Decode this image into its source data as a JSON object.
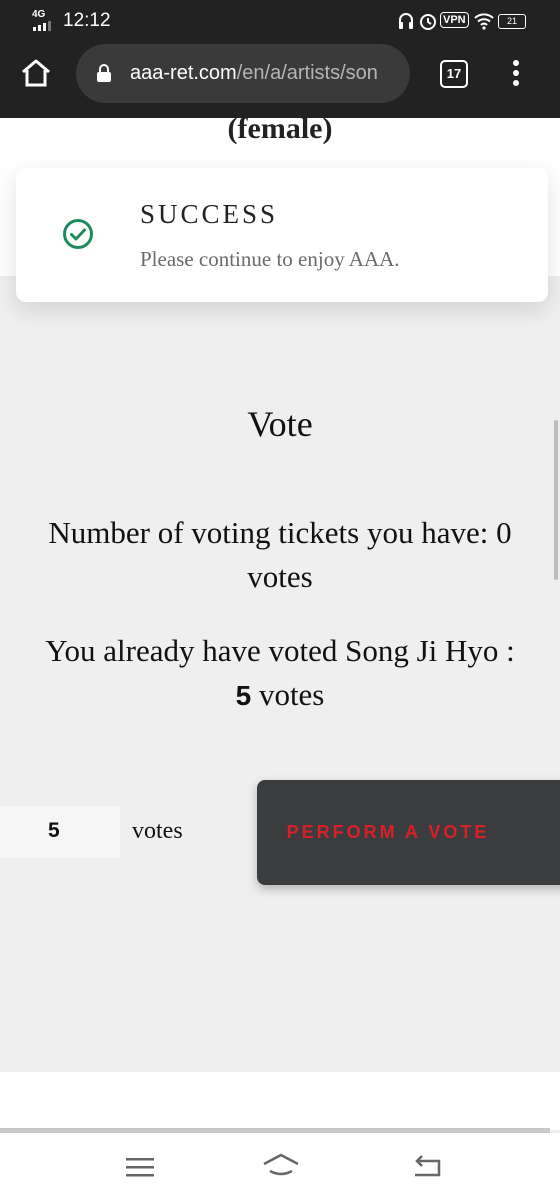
{
  "status_bar": {
    "network": "4G",
    "time": "12:12",
    "vpn": "VPN",
    "battery": "21"
  },
  "browser": {
    "url_domain": "aaa-ret.com",
    "url_path": "/en/a/artists/son",
    "tab_count": "17"
  },
  "page": {
    "heading_partial": "(female)",
    "toast": {
      "title": "SUCCESS",
      "message": "Please continue to enjoy AAA."
    },
    "vote": {
      "title": "Vote",
      "tickets_line1": "Number of voting tickets you have: 0",
      "tickets_line2": "votes",
      "already_line1": "You already have voted Song Ji Hyo :",
      "already_count": "5",
      "already_unit": " votes",
      "quantity_value": "5",
      "quantity_unit": "votes",
      "perform_label": "PERFORM A VOTE"
    }
  },
  "colors": {
    "success": "#1e8a5e",
    "accent_red": "#d82026",
    "button_bg": "#3b3c3e"
  }
}
